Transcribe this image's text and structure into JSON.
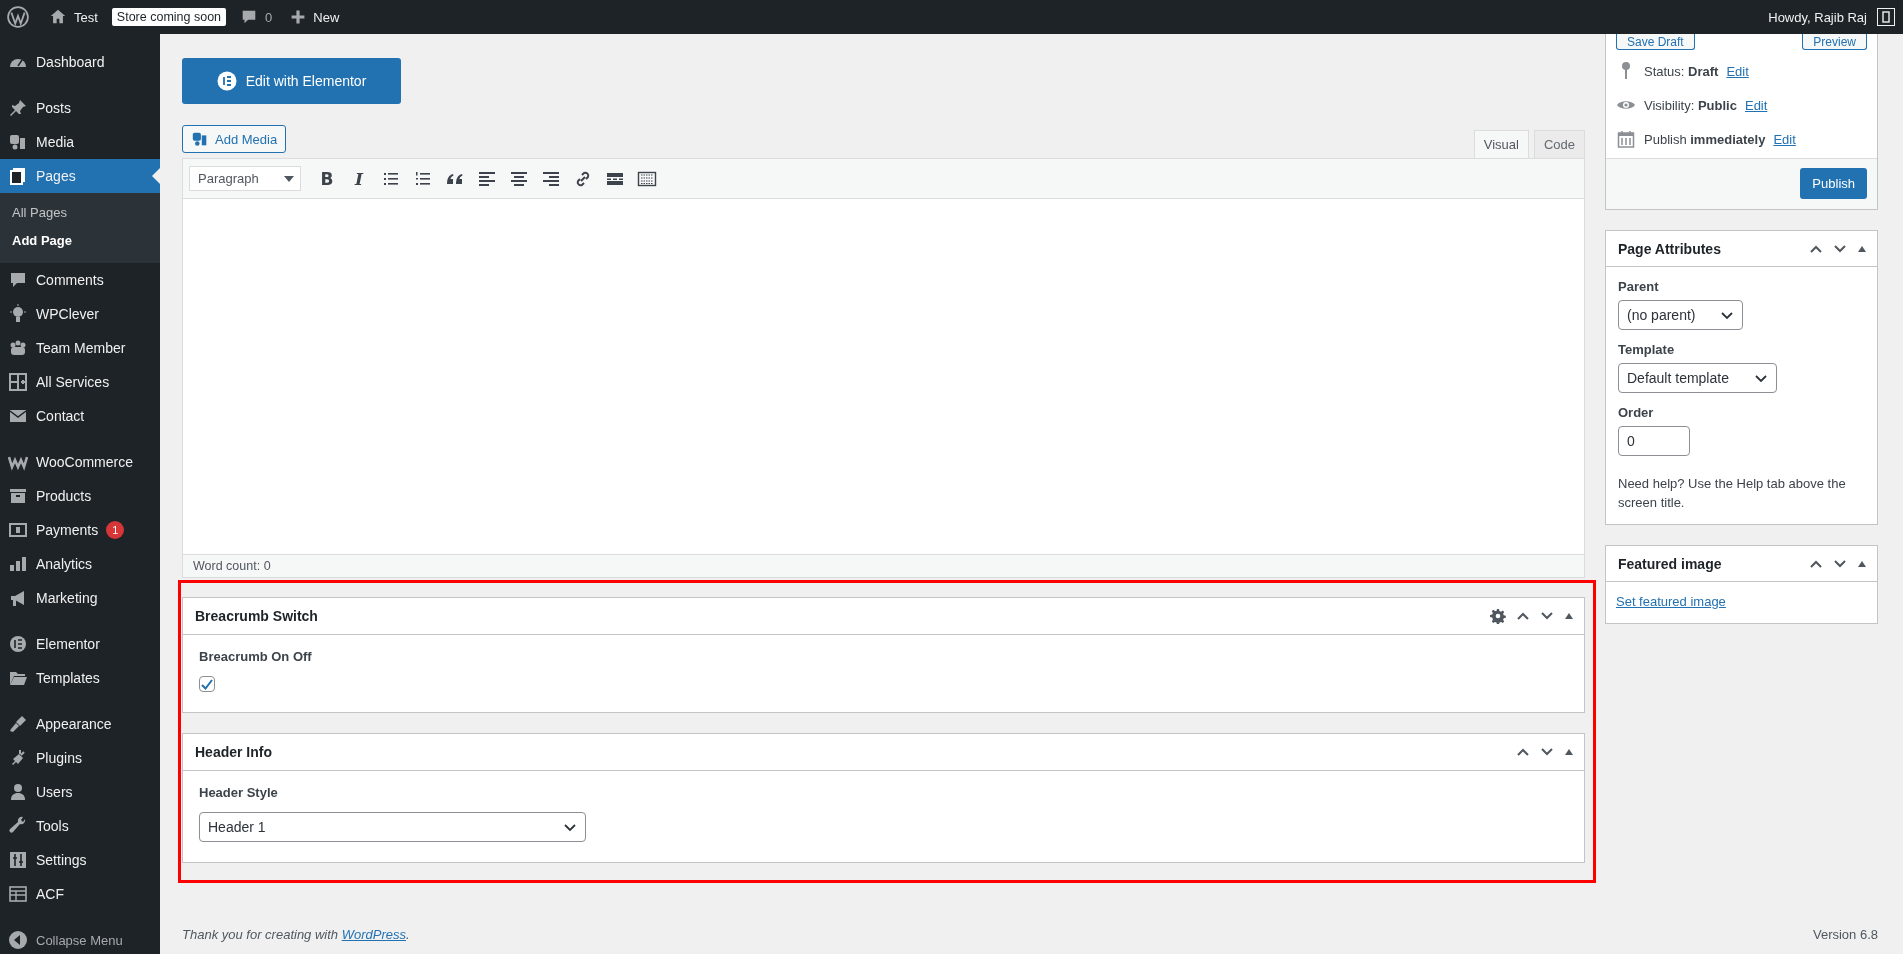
{
  "admin_bar": {
    "site_name": "Test",
    "store_badge": "Store coming soon",
    "comments_count": "0",
    "new_label": "New",
    "greeting": "Howdy, Rajib Raj"
  },
  "sidebar": {
    "groups": [
      [
        {
          "label": "Dashboard",
          "selected": false
        }
      ],
      [
        {
          "label": "Posts",
          "selected": false
        },
        {
          "label": "Media",
          "selected": false
        },
        {
          "label": "Pages",
          "selected": true,
          "children": [
            {
              "label": "All Pages",
              "selected": false
            },
            {
              "label": "Add Page",
              "selected": true
            }
          ]
        },
        {
          "label": "Comments",
          "selected": false
        },
        {
          "label": "WPClever",
          "selected": false
        },
        {
          "label": "Team Member",
          "selected": false
        },
        {
          "label": "All Services",
          "selected": false
        },
        {
          "label": "Contact",
          "selected": false
        }
      ],
      [
        {
          "label": "WooCommerce",
          "selected": false
        },
        {
          "label": "Products",
          "selected": false
        },
        {
          "label": "Payments",
          "selected": false,
          "badge": "1"
        },
        {
          "label": "Analytics",
          "selected": false
        },
        {
          "label": "Marketing",
          "selected": false
        }
      ],
      [
        {
          "label": "Elementor",
          "selected": false
        },
        {
          "label": "Templates",
          "selected": false
        }
      ],
      [
        {
          "label": "Appearance",
          "selected": false
        },
        {
          "label": "Plugins",
          "selected": false
        },
        {
          "label": "Users",
          "selected": false
        },
        {
          "label": "Tools",
          "selected": false
        },
        {
          "label": "Settings",
          "selected": false
        },
        {
          "label": "ACF",
          "selected": false
        }
      ]
    ],
    "collapse_label": "Collapse Menu"
  },
  "editor": {
    "elementor_button": "Edit with Elementor",
    "add_media": "Add Media",
    "tabs": [
      {
        "label": "Visual",
        "selected": true
      },
      {
        "label": "Code",
        "selected": false
      }
    ],
    "format_select": "Paragraph",
    "format_buttons": [
      "B",
      "I"
    ],
    "word_count": "Word count: 0"
  },
  "meta_boxes": [
    {
      "title": "Breacrumb Switch",
      "has_settings": true,
      "fields": [
        {
          "kind": "checkbox",
          "label": "Breacrumb On Off",
          "checked": true
        }
      ]
    },
    {
      "title": "Header Info",
      "has_settings": false,
      "fields": [
        {
          "kind": "select",
          "label": "Header Style",
          "value": "Header 1"
        }
      ]
    }
  ],
  "publish_box": {
    "buttons": [
      "Save Draft",
      "Preview"
    ],
    "rows": [
      {
        "label": "Status:",
        "value": "Draft",
        "link": "Edit"
      },
      {
        "label": "Visibility:",
        "value": "Public",
        "link": "Edit"
      },
      {
        "label": "Publish",
        "value": "immediately",
        "link": "Edit"
      }
    ],
    "publish_button": "Publish"
  },
  "page_attributes": {
    "title": "Page Attributes",
    "fields": [
      {
        "kind": "select",
        "label": "Parent",
        "value": "(no parent)"
      },
      {
        "kind": "select",
        "label": "Template",
        "value": "Default template"
      },
      {
        "kind": "number",
        "label": "Order",
        "value": "0"
      }
    ],
    "help": "Need help? Use the Help tab above the screen title."
  },
  "featured_image": {
    "title": "Featured image",
    "link": "Set featured image"
  },
  "footer": {
    "thanks": "Thank you for creating with ",
    "link": "WordPress",
    "suffix": ".",
    "version": "Version 6.8"
  }
}
